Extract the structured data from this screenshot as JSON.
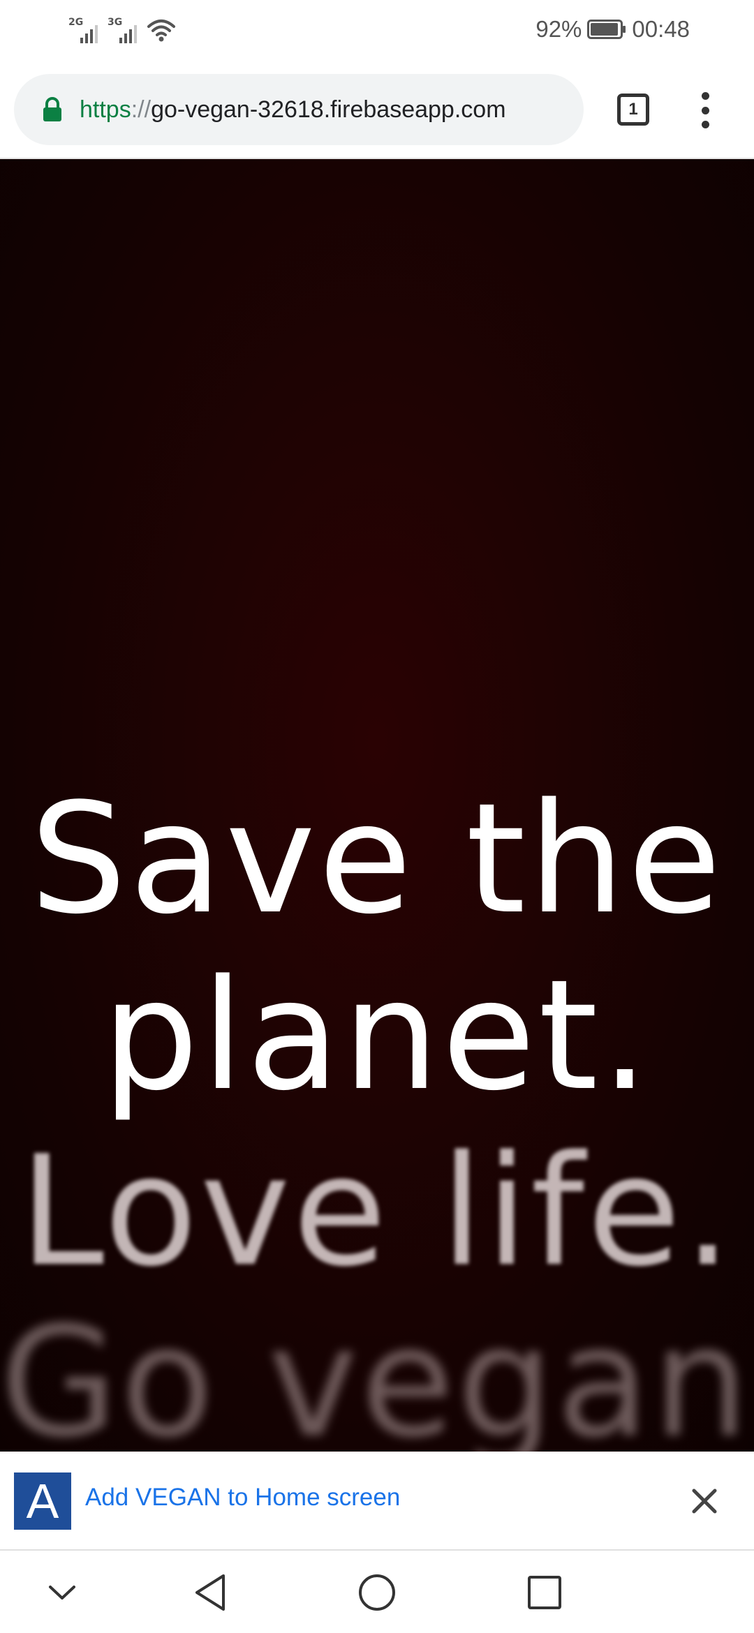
{
  "status_bar": {
    "sim1_label": "2G",
    "sim2_label": "3G",
    "battery_percent": "92%",
    "time": "00:48",
    "wifi_icon": "wifi-icon",
    "battery_icon": "battery-icon"
  },
  "browser": {
    "url_scheme": "https",
    "url_separator": "://",
    "url_host": "go-vegan-32618.firebaseapp.com",
    "tab_count": "1",
    "lock_icon": "lock-icon",
    "menu_icon": "more-vert-icon"
  },
  "hero": {
    "line1": "Save the",
    "line2": "planet.",
    "line3": "Love life.",
    "line4": "Go vegan.",
    "background_color": "#1f0303",
    "text_color": "#ffffff"
  },
  "install_banner": {
    "icon_letter": "A",
    "text": "Add VEGAN to Home screen",
    "icon_color": "#1f4e99",
    "text_color": "#1a73e8"
  },
  "nav_bar": {
    "icons": [
      "chevron-down-icon",
      "back-icon",
      "home-icon",
      "recents-icon"
    ]
  }
}
